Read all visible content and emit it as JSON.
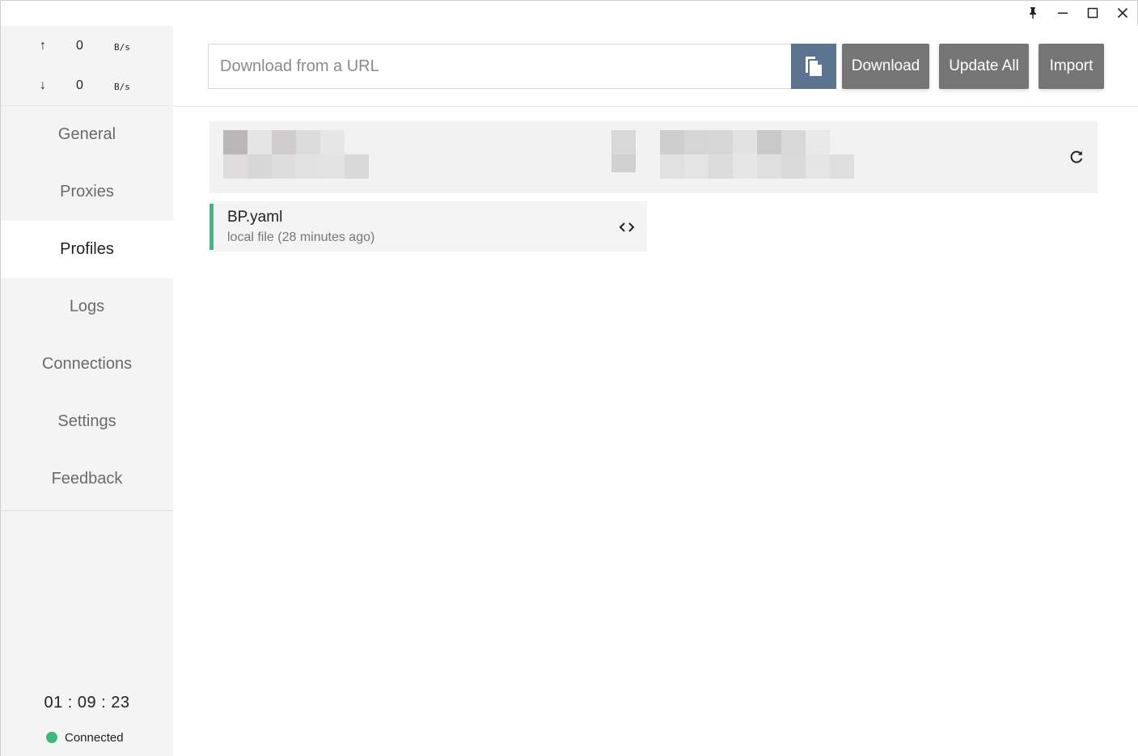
{
  "window": {
    "controls": {
      "pin_icon": "pin-icon",
      "minimize_icon": "minimize-icon",
      "maximize_icon": "maximize-icon",
      "close_icon": "close-icon"
    }
  },
  "sidebar": {
    "traffic": {
      "up": {
        "arrow": "↑",
        "value": "0",
        "unit": "B/s"
      },
      "down": {
        "arrow": "↓",
        "value": "0",
        "unit": "B/s"
      }
    },
    "nav": [
      {
        "label": "General"
      },
      {
        "label": "Proxies"
      },
      {
        "label": "Profiles"
      },
      {
        "label": "Logs"
      },
      {
        "label": "Connections"
      },
      {
        "label": "Settings"
      },
      {
        "label": "Feedback"
      }
    ],
    "active_nav": "Profiles",
    "uptime": "01 : 09 : 23",
    "status": {
      "label": "Connected",
      "color": "#3cba7f"
    }
  },
  "toolbar": {
    "url_placeholder": "Download from a URL",
    "url_value": "",
    "paste_icon": "paste-icon",
    "paste_color": "#5b7590",
    "download_label": "Download",
    "update_all_label": "Update All",
    "import_label": "Import",
    "button_color": "#757575"
  },
  "profiles": {
    "redacted_card": {
      "refresh_icon": "refresh-icon"
    },
    "items": [
      {
        "name": "BP.yaml",
        "subtitle": "local file (28 minutes ago)",
        "accent": "#3cba7f",
        "edit_icon": "code-icon"
      }
    ]
  }
}
